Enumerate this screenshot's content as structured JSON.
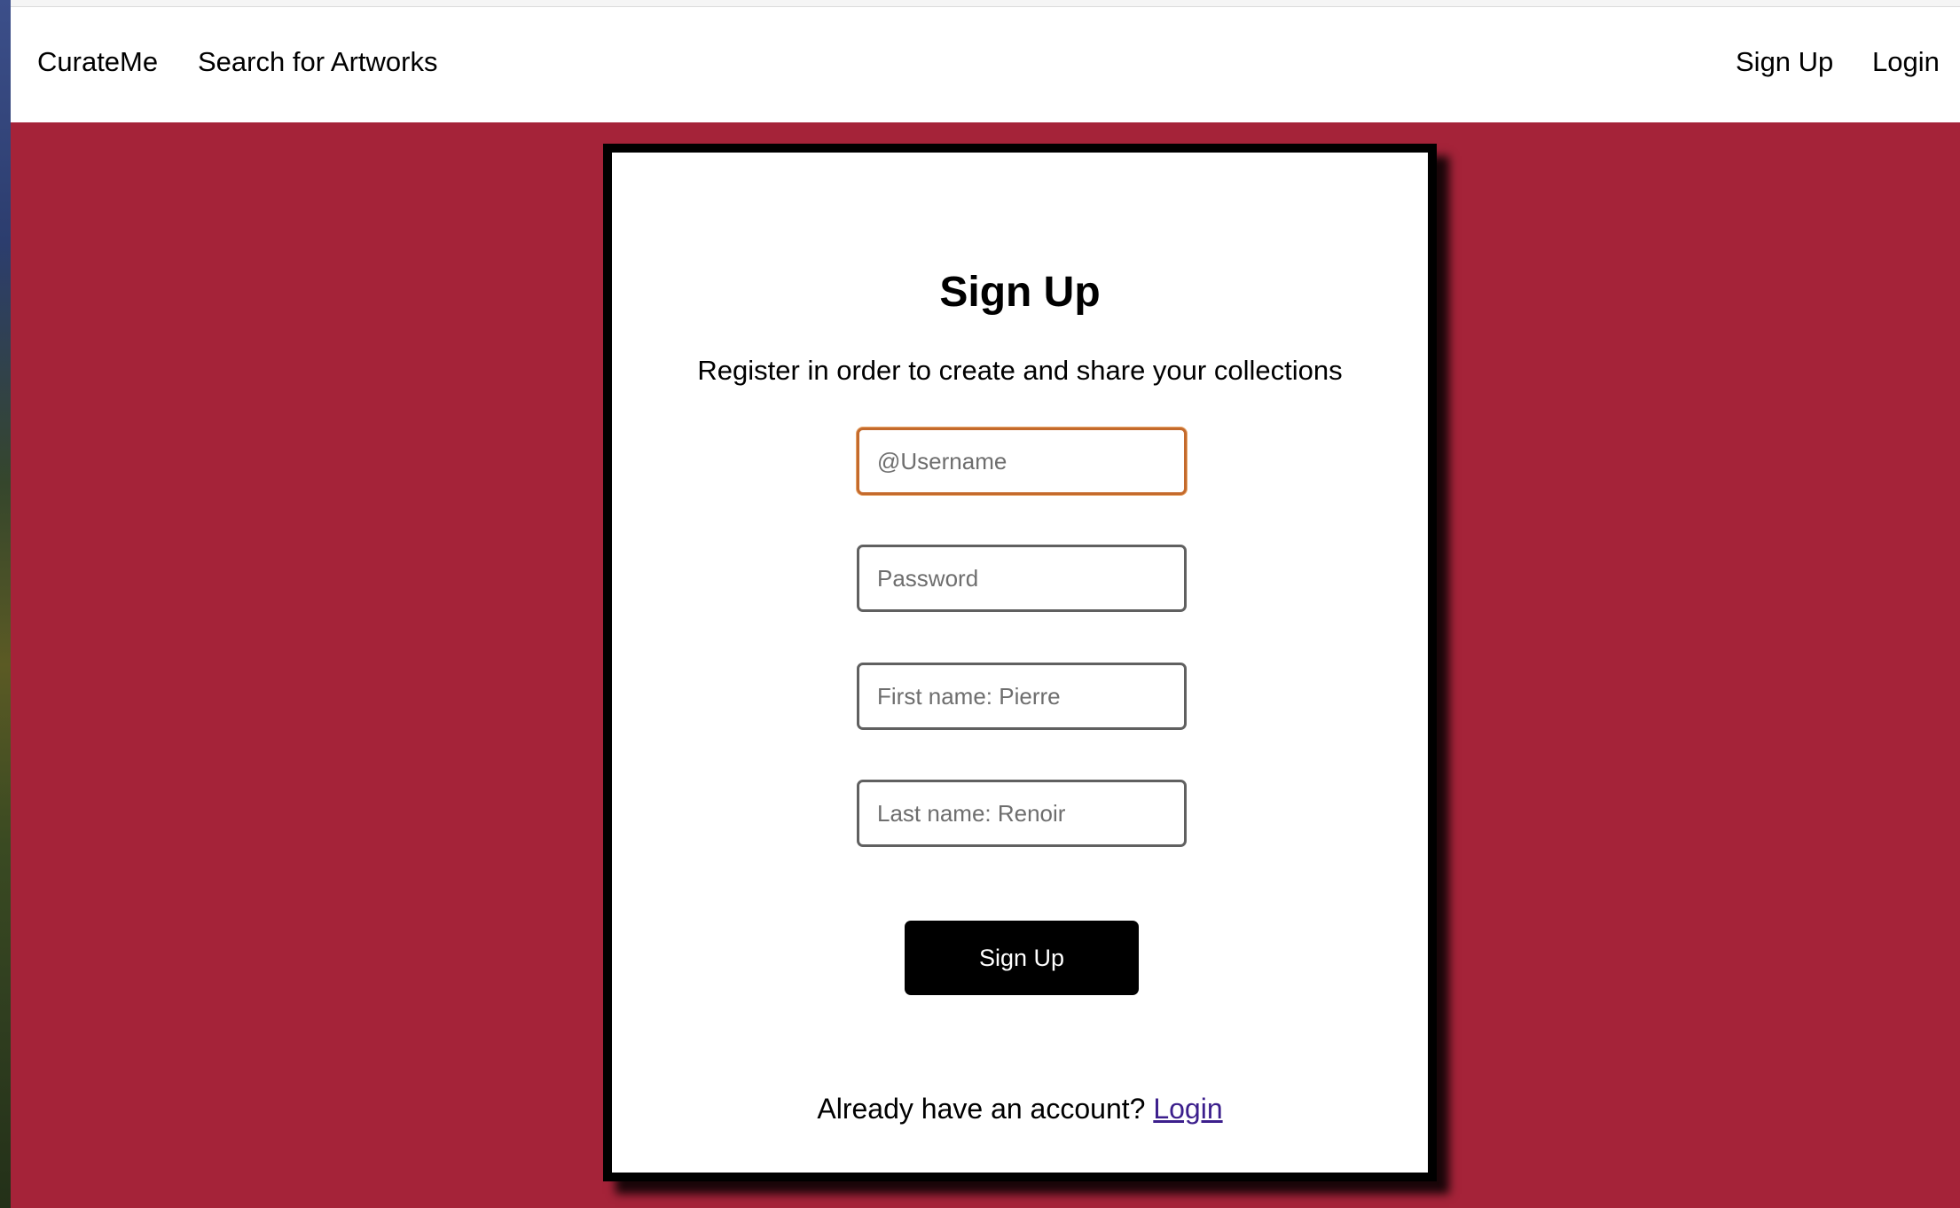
{
  "nav": {
    "brand": "CurateMe",
    "search_link": "Search for Artworks",
    "signup_link": "Sign Up",
    "login_link": "Login"
  },
  "form": {
    "title": "Sign Up",
    "subtitle": "Register in order to create and share your collections",
    "username_placeholder": "@Username",
    "password_placeholder": "Password",
    "first_name_placeholder": "First name: Pierre",
    "last_name_placeholder": "Last name: Renoir",
    "submit_label": "Sign Up",
    "footer_text": "Already have an account?",
    "footer_link": "Login"
  },
  "colors": {
    "background": "#a52339",
    "card_border": "#000000",
    "focus_border": "#c46a2c",
    "link": "#3c1f8c"
  }
}
